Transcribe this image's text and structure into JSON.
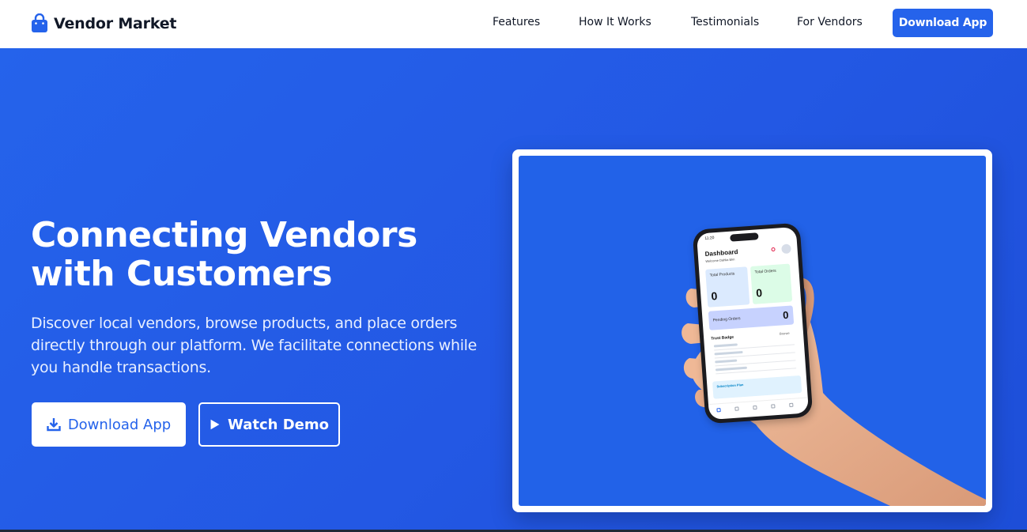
{
  "brand": {
    "name": "Vendor Market",
    "icon": "shopping-bag-icon"
  },
  "nav": {
    "links": [
      "Features",
      "How It Works",
      "Testimonials",
      "For Vendors"
    ],
    "cta_label": "Download App"
  },
  "hero": {
    "title": "Connecting Vendors with Customers",
    "subtitle": "Discover local vendors, browse products, and place orders directly through our platform. We facilitate connections while you handle transactions.",
    "primary_button": {
      "label": "Download App",
      "icon": "download-icon"
    },
    "secondary_button": {
      "label": "Watch Demo",
      "icon": "play-icon"
    }
  },
  "phone_screen": {
    "time": "11:20",
    "title": "Dashboard",
    "welcome": "Welcome Dahlia Ekn",
    "total_products_label": "Total Products",
    "total_products_value": "0",
    "total_orders_label": "Total Orders",
    "total_orders_value": "0",
    "pending_orders_label": "Pending Orders",
    "pending_orders_value": "0",
    "trust_badge_label": "Trust Badge",
    "trust_badge_level": "Bronze",
    "subscription_label": "Subscription Plan"
  },
  "colors": {
    "primary": "#2563eb",
    "hero_background": "#2563eb",
    "text_dark": "#111827"
  }
}
